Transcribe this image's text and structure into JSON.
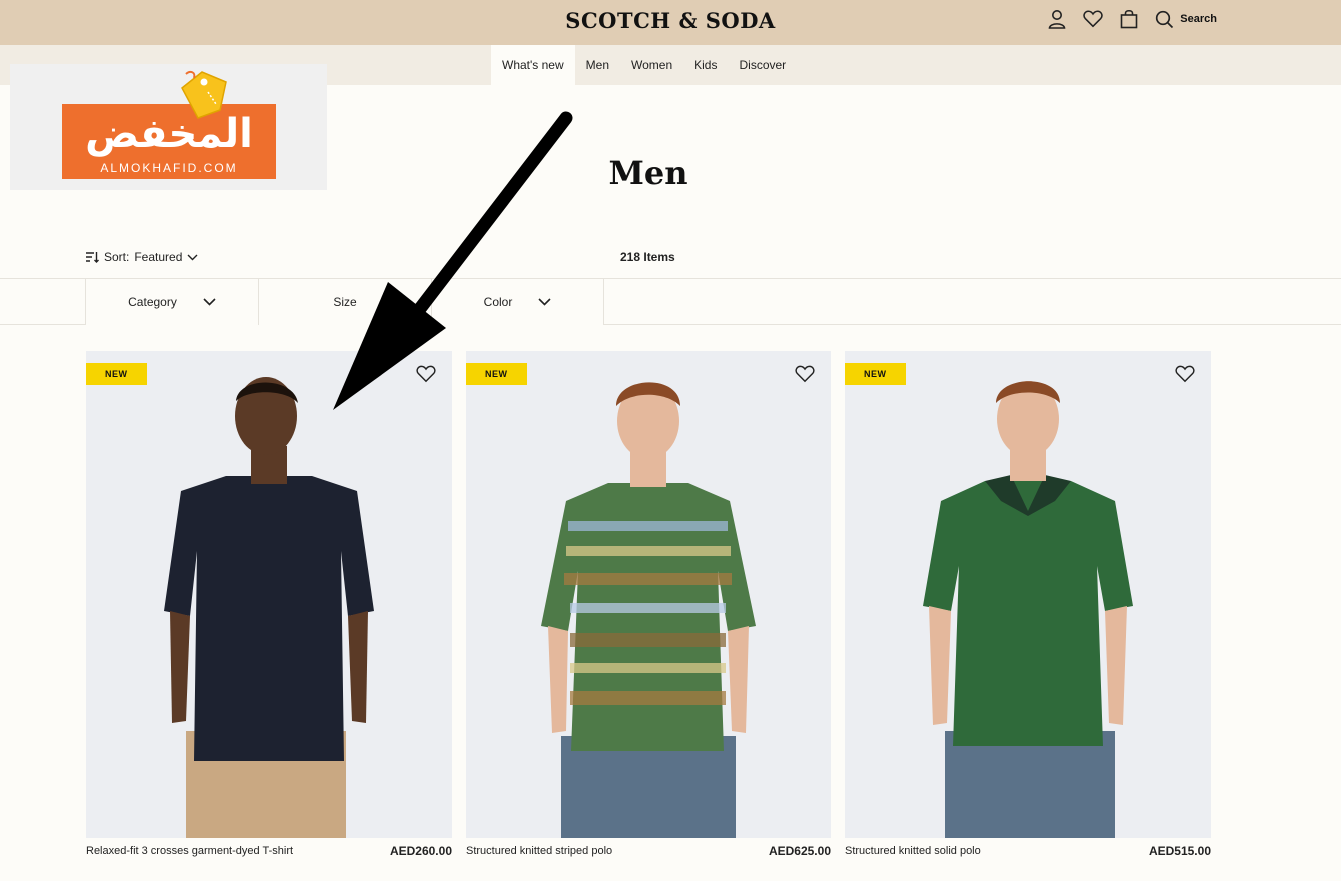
{
  "header": {
    "brand": "SCOTCH & SODA",
    "search_label": "Search",
    "bg_color": "#e0cdb4"
  },
  "nav": {
    "items": [
      {
        "label": "What's new",
        "active": true
      },
      {
        "label": "Men"
      },
      {
        "label": "Women"
      },
      {
        "label": "Kids"
      },
      {
        "label": "Discover"
      }
    ]
  },
  "watermark": {
    "arabic": "المخفض",
    "latin": "ALMOKHAFID.COM",
    "color": "#ee6f2d"
  },
  "page": {
    "title": "Men"
  },
  "toolbar": {
    "sort_label": "Sort:",
    "sort_value": "Featured",
    "item_count": "218 Items"
  },
  "filters": [
    {
      "label": "Category"
    },
    {
      "label": "Size"
    },
    {
      "label": "Color"
    }
  ],
  "products": [
    {
      "badge": "NEW",
      "name": "Relaxed-fit 3 crosses garment-dyed T-shirt",
      "price": "AED260.00",
      "shirt_color": "#1d2230",
      "bottom_color": "#c9a882"
    },
    {
      "badge": "NEW",
      "name": "Structured knitted striped polo",
      "price": "AED625.00",
      "shirt_color": "#4e7a48",
      "bottom_color": "#5b7289"
    },
    {
      "badge": "NEW",
      "name": "Structured knitted solid polo",
      "price": "AED515.00",
      "shirt_color": "#2f6a3a",
      "bottom_color": "#5b7289"
    }
  ]
}
